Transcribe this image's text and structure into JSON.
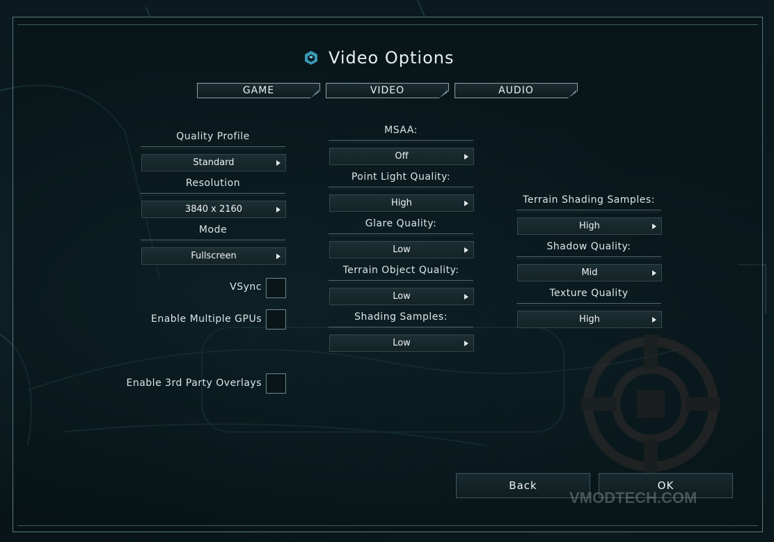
{
  "title": "Video Options",
  "tabs": [
    "GAME",
    "VIDEO",
    "AUDIO"
  ],
  "left": {
    "quality_profile": {
      "label": "Quality Profile",
      "value": "Standard"
    },
    "resolution": {
      "label": "Resolution",
      "value": "3840 x 2160"
    },
    "mode": {
      "label": "Mode",
      "value": "Fullscreen"
    },
    "vsync": {
      "label": "VSync",
      "checked": false
    },
    "multi_gpu": {
      "label": "Enable Multiple GPUs",
      "checked": false
    },
    "overlays": {
      "label": "Enable 3rd Party Overlays",
      "checked": false
    }
  },
  "middle": {
    "msaa": {
      "label": "MSAA:",
      "value": "Off"
    },
    "point_light": {
      "label": "Point Light Quality:",
      "value": "High"
    },
    "glare": {
      "label": "Glare Quality:",
      "value": "Low"
    },
    "terrain_object": {
      "label": "Terrain Object Quality:",
      "value": "Low"
    },
    "shading_samples": {
      "label": "Shading Samples:",
      "value": "Low"
    }
  },
  "right": {
    "terrain_shading": {
      "label": "Terrain Shading Samples:",
      "value": "High"
    },
    "shadow": {
      "label": "Shadow Quality:",
      "value": "Mid"
    },
    "texture": {
      "label": "Texture Quality",
      "value": "High"
    }
  },
  "buttons": {
    "back": "Back",
    "ok": "OK"
  },
  "watermark": "VMODTECH.COM",
  "colors": {
    "accent": "#5fb3c8",
    "panel_border": "#5a7b80",
    "text": "#dce6e8"
  }
}
